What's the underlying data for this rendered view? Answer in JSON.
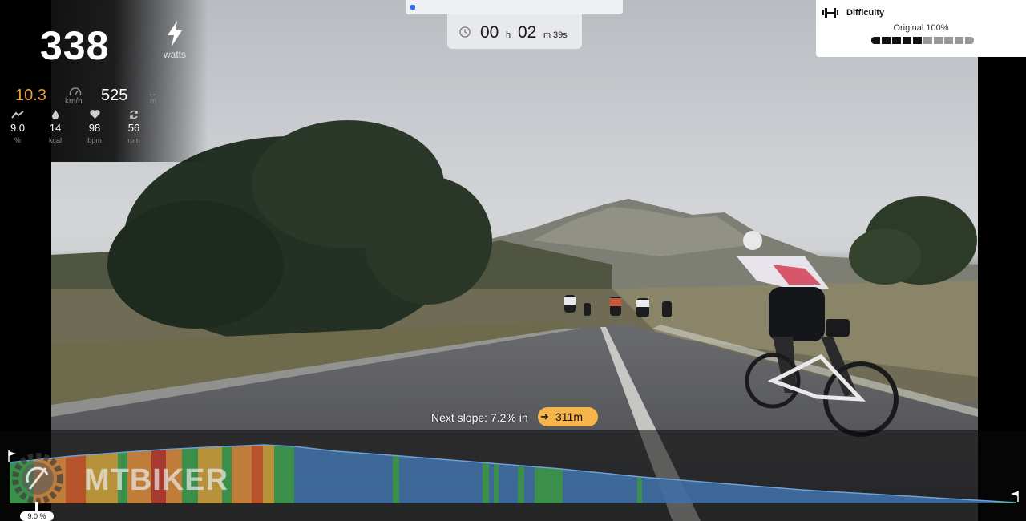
{
  "stats": {
    "power": {
      "value": "338",
      "unit": "watts",
      "icon": "lightning-bolt-icon"
    },
    "speed": {
      "value": "10.3",
      "unit": "km/h",
      "icon": "speedometer-icon",
      "color": "#f59b3a"
    },
    "distance": {
      "value": "525",
      "unit": "m",
      "icon": "distance-arrows-icon"
    },
    "metrics": [
      {
        "name": "grade",
        "icon": "incline-icon",
        "value": "9.0",
        "unit": "%"
      },
      {
        "name": "calories",
        "icon": "flame-icon",
        "value": "14",
        "unit": "kcal"
      },
      {
        "name": "heart-rate",
        "icon": "heart-icon",
        "value": "98",
        "unit": "bpm"
      },
      {
        "name": "cadence",
        "icon": "cadence-icon",
        "value": "56",
        "unit": "rpm"
      }
    ]
  },
  "timer": {
    "hours": "00",
    "hours_unit": "h",
    "minutes": "02",
    "minutes_unit": "m",
    "seconds": "39s"
  },
  "route_progress": 0.02,
  "difficulty": {
    "title": "Difficulty",
    "value": "Original 100%",
    "segments_total": 10,
    "segments_filled": 5
  },
  "next_slope": {
    "text": "Next slope: 7.2% in",
    "distance": "311m"
  },
  "profile": {
    "current_grade": "9.0 %"
  },
  "watermark": {
    "text": "MTBIKER"
  },
  "colors": {
    "accent_orange": "#f59b3a",
    "pill_yellow": "#f5b54b",
    "progress_blue": "#2f6fe6"
  }
}
